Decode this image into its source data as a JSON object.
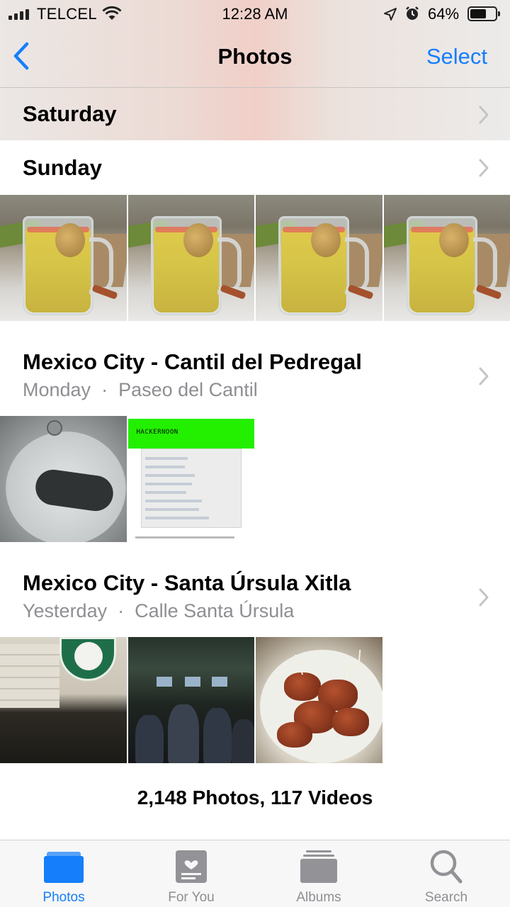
{
  "status_bar": {
    "carrier": "TELCEL",
    "time": "12:28 AM",
    "battery_percent": "64%",
    "battery_level": 0.64,
    "icons": [
      "signal-icon",
      "wifi-icon",
      "location-arrow-icon",
      "alarm-icon",
      "battery-icon"
    ]
  },
  "nav": {
    "back_icon": "chevron-left-icon",
    "title": "Photos",
    "select_label": "Select"
  },
  "moments": [
    {
      "title": "Saturday"
    },
    {
      "title": "Sunday",
      "photos": [
        "beer-mug-photo",
        "beer-mug-photo",
        "beer-mug-photo",
        "beer-mug-photo"
      ]
    },
    {
      "title": "Mexico City - Cantil del Pedregal",
      "date": "Monday",
      "separator": "·",
      "place": "Paseo del Cantil",
      "photos": [
        "pressure-gauge-photo",
        "hackernoon-screenshot"
      ]
    },
    {
      "title": "Mexico City - Santa Úrsula Xitla",
      "date": "Yesterday",
      "separator": "·",
      "place": "Calle Santa Úrsula",
      "photos": [
        "irish-pub-sign-photo",
        "bar-interior-photo",
        "chicken-wings-photo"
      ]
    }
  ],
  "screenshot_logo": "HACKERNOON",
  "library_counts": "2,148 Photos, 117 Videos",
  "tab_bar": {
    "tabs": [
      {
        "label": "Photos",
        "icon": "photos-tab-icon",
        "active": true
      },
      {
        "label": "For You",
        "icon": "for-you-tab-icon",
        "active": false
      },
      {
        "label": "Albums",
        "icon": "albums-tab-icon",
        "active": false
      },
      {
        "label": "Search",
        "icon": "search-tab-icon",
        "active": false
      }
    ]
  },
  "colors": {
    "accent": "#147efb",
    "secondary_text": "#8e8e93",
    "tab_bar_bg": "#f7f7f7"
  }
}
